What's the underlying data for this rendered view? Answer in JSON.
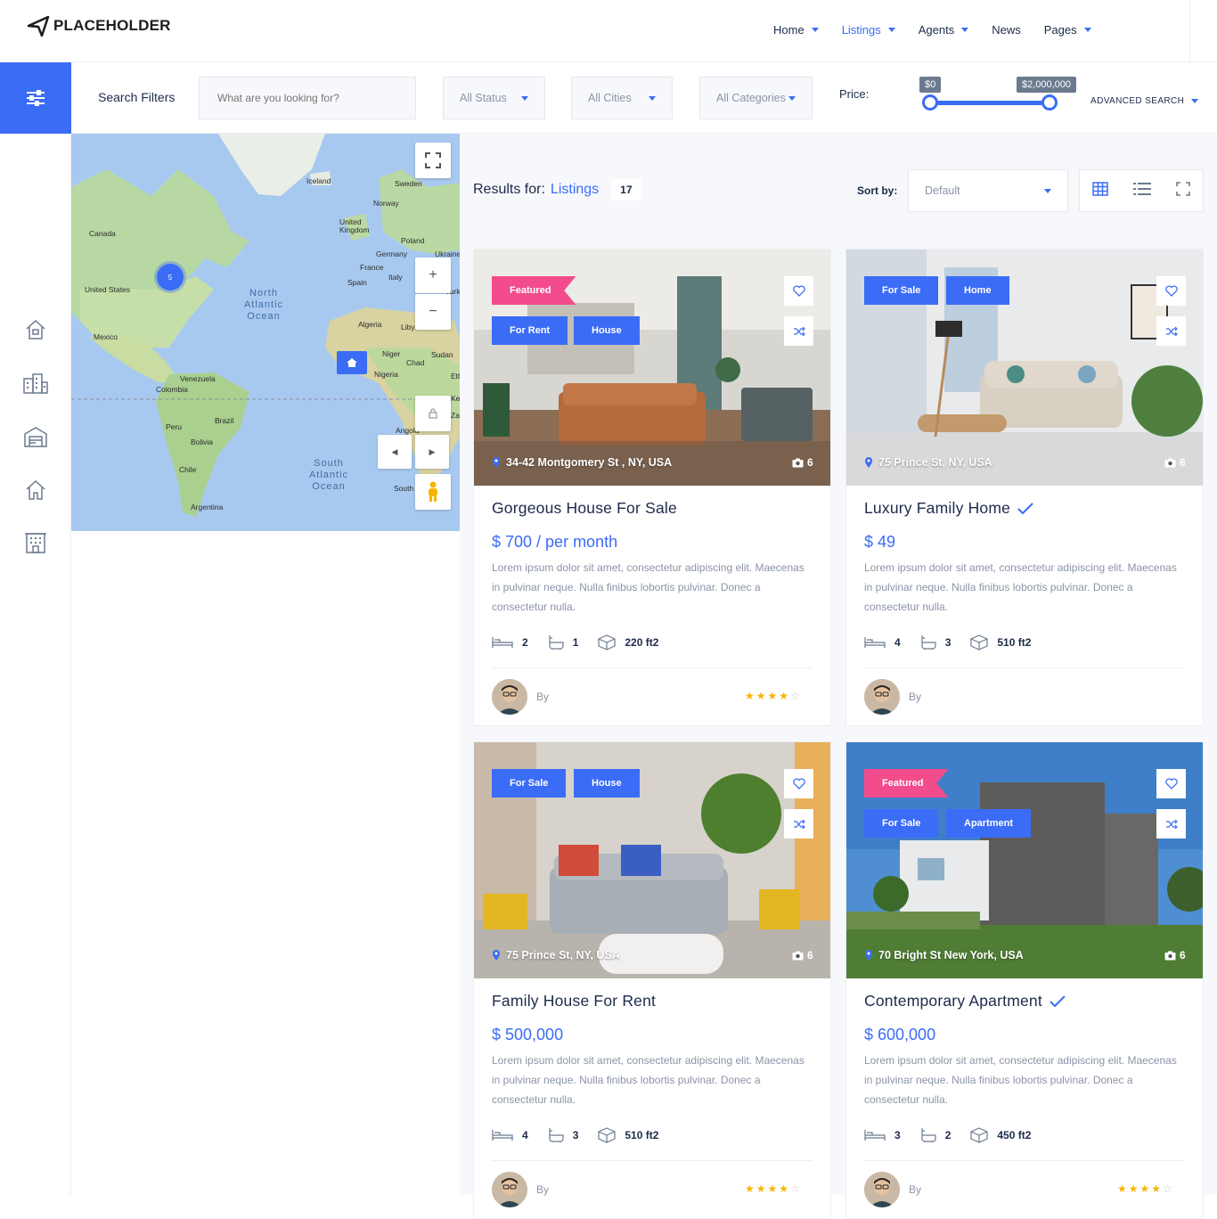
{
  "brand": {
    "name": "PLACEHOLDER"
  },
  "nav": [
    {
      "label": "Home",
      "has_menu": true,
      "active": false
    },
    {
      "label": "Listings",
      "has_menu": true,
      "active": true
    },
    {
      "label": "Agents",
      "has_menu": true,
      "active": false
    },
    {
      "label": "News",
      "has_menu": false,
      "active": false
    },
    {
      "label": "Pages",
      "has_menu": true,
      "active": false
    }
  ],
  "filters": {
    "title": "Search Filters",
    "search_placeholder": "What are you looking for?",
    "status": "All Status",
    "cities": "All Cities",
    "categories": "All Categories",
    "price_label": "Price:",
    "price_min": "$0",
    "price_max": "$2,000,000",
    "advanced": "ADVANCED SEARCH"
  },
  "map": {
    "cluster_count": "5",
    "labels": {
      "iceland": "Iceland",
      "sweden": "Sweden",
      "norway": "Norway",
      "uk": "United Kingdom",
      "poland": "Poland",
      "germany": "Germany",
      "ukraine": "Ukraine",
      "france": "France",
      "spain": "Spain",
      "italy": "Italy",
      "turk": "Turk",
      "canada": "Canada",
      "us": "United States",
      "mexico": "Mexico",
      "algeria": "Algeria",
      "libya": "Libya",
      "niger": "Niger",
      "chad": "Chad",
      "sudan": "Sudan",
      "nigeria": "Nigeria",
      "eth": "Eth",
      "venezuela": "Venezuela",
      "colombia": "Colombia",
      "brazil": "Brazil",
      "peru": "Peru",
      "bolivia": "Bolivia",
      "chile": "Chile",
      "argentina": "Argentina",
      "angola": "Angola",
      "south": "South",
      "ke": "Ke",
      "za": "Za"
    },
    "north_atlantic": "North Atlantic Ocean",
    "south_atlantic": "South Atlantic Ocean"
  },
  "results": {
    "prefix": "Results for:",
    "link": "Listings",
    "count": "17"
  },
  "sort": {
    "label": "Sort by:",
    "value": "Default"
  },
  "listings": [
    {
      "featured": "Featured",
      "tags": [
        "For Rent",
        "House"
      ],
      "address": "34-42 Montgomery St , NY, USA",
      "photos": "6",
      "title": "Gorgeous House For Sale",
      "verified": false,
      "price": "$ 700 / per month",
      "desc": "Lorem ipsum dolor sit amet, consectetur adipiscing elit. Maecenas in pulvinar neque. Nulla finibus lobortis pulvinar. Donec a consectetur nulla.",
      "beds": "2",
      "baths": "1",
      "area": "220 ft2",
      "by": "By",
      "rating": 4
    },
    {
      "featured": "",
      "tags": [
        "For Sale",
        "Home"
      ],
      "address": "75 Prince St, NY, USA",
      "photos": "6",
      "title": "Luxury Family Home",
      "verified": true,
      "price": "$ 49",
      "desc": "Lorem ipsum dolor sit amet, consectetur adipiscing elit. Maecenas in pulvinar neque. Nulla finibus lobortis pulvinar. Donec a consectetur nulla.",
      "beds": "4",
      "baths": "3",
      "area": "510 ft2",
      "by": "By",
      "rating": 0
    },
    {
      "featured": "",
      "tags": [
        "For Sale",
        "House"
      ],
      "address": "75 Prince St, NY, USA",
      "photos": "6",
      "title": "Family House For Rent",
      "verified": false,
      "price": "$ 500,000",
      "desc": "Lorem ipsum dolor sit amet, consectetur adipiscing elit. Maecenas in pulvinar neque. Nulla finibus lobortis pulvinar. Donec a consectetur nulla.",
      "beds": "4",
      "baths": "3",
      "area": "510 ft2",
      "by": "By",
      "rating": 4
    },
    {
      "featured": "Featured",
      "tags": [
        "For Sale",
        "Apartment"
      ],
      "address": "70 Bright St New York, USA",
      "photos": "6",
      "title": "Contemporary Apartment",
      "verified": true,
      "price": "$ 600,000",
      "desc": "Lorem ipsum dolor sit amet, consectetur adipiscing elit. Maecenas in pulvinar neque. Nulla finibus lobortis pulvinar. Donec a consectetur nulla.",
      "beds": "3",
      "baths": "2",
      "area": "450 ft2",
      "by": "By",
      "rating": 4
    }
  ],
  "colors": {
    "accent": "#3b6cf6",
    "featured": "#f24c8c",
    "star": "#f7b500"
  }
}
